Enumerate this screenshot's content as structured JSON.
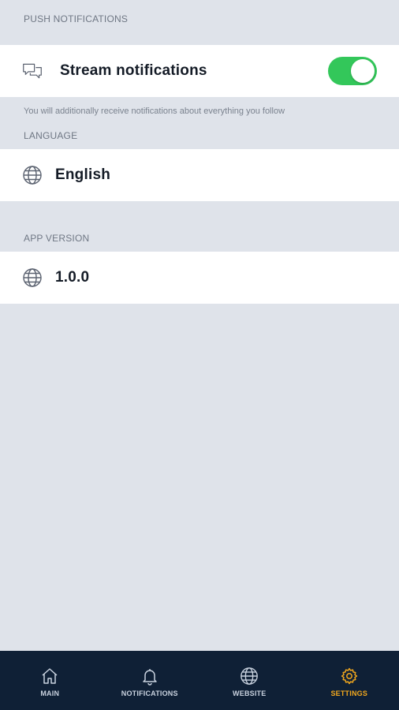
{
  "sections": {
    "push": {
      "header": "PUSH NOTIFICATIONS",
      "row_label": "Stream notifications",
      "toggle_on": true,
      "footnote": "You will additionally receive notifications about everything you follow"
    },
    "language": {
      "header": "LANGUAGE",
      "value": "English"
    },
    "version": {
      "header": "APP VERSION",
      "value": "1.0.0"
    }
  },
  "tabbar": {
    "tabs": [
      {
        "label": "MAIN",
        "icon": "home-icon"
      },
      {
        "label": "NOTIFICATIONS",
        "icon": "bell-icon"
      },
      {
        "label": "WEBSITE",
        "icon": "globe-icon"
      },
      {
        "label": "SETTINGS",
        "icon": "gear-icon"
      }
    ],
    "active": "SETTINGS"
  },
  "colors": {
    "background": "#dfe3ea",
    "tabbar": "#0f2036",
    "accent": "#f2a81d",
    "toggle": "#33c75a"
  }
}
